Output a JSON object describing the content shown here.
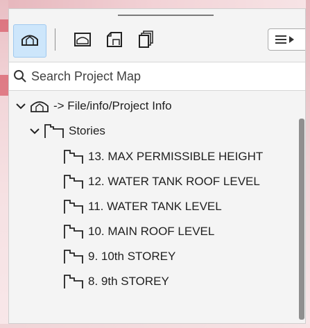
{
  "search": {
    "placeholder": "Search Project Map"
  },
  "tree": {
    "project": {
      "label": "-> File/info/Project Info"
    },
    "stories": {
      "label": "Stories"
    },
    "items": [
      {
        "label": "13. MAX PERMISSIBLE HEIGHT"
      },
      {
        "label": "12. WATER TANK ROOF LEVEL"
      },
      {
        "label": "11. WATER TANK LEVEL"
      },
      {
        "label": "10. MAIN ROOF LEVEL"
      },
      {
        "label": "9. 10th STOREY"
      },
      {
        "label": "8. 9th STOREY"
      }
    ]
  },
  "icons": {
    "project_map": "project-map-icon",
    "view_map": "view-map-icon",
    "layout_book": "layout-book-icon",
    "publisher_sets": "publisher-sets-icon",
    "menu": "menu-icon"
  },
  "colors": {
    "active_tab_bg": "#cde6fb",
    "active_tab_border": "#9fc8ef",
    "panel_bg": "#f4f4f4",
    "tree_text": "#1f1f1f"
  }
}
